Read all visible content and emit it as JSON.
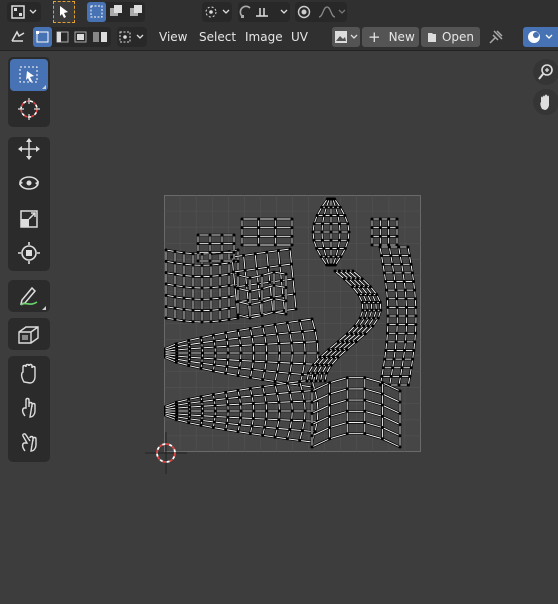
{
  "header": {
    "menus": [
      "View",
      "Select",
      "Image",
      "UV"
    ],
    "new_label": "New",
    "open_label": "Open"
  },
  "colors": {
    "header_bg": "#303030",
    "viewport_bg": "#3d3d3d",
    "accent": "#4772b3",
    "cursor_red": "#e04545",
    "mesh_white": "#ffffff"
  },
  "icons": {
    "editor_type": "image-editor-icon",
    "select_mode": "cursor-arrow-icon",
    "pivot": "pivot-point-icon",
    "snap": "snap-icon",
    "proportional": "proportional-editing-icon",
    "sync": "uv-sync-icon",
    "pin": "pin-icon"
  },
  "toolbar": {
    "tools": [
      {
        "name": "select-box-tool",
        "icon": "select-box-icon"
      },
      {
        "name": "cursor-tool",
        "icon": "cursor-icon"
      },
      {
        "name": "move-tool",
        "icon": "move-icon"
      },
      {
        "name": "rotate-tool",
        "icon": "rotate-icon"
      },
      {
        "name": "scale-tool",
        "icon": "scale-icon"
      },
      {
        "name": "transform-tool",
        "icon": "transform-icon"
      },
      {
        "name": "annotate-tool",
        "icon": "annotate-icon"
      },
      {
        "name": "rip-region-tool",
        "icon": "rip-region-icon"
      },
      {
        "name": "grab-tool",
        "icon": "grab-icon"
      },
      {
        "name": "relax-tool",
        "icon": "relax-icon"
      },
      {
        "name": "pinch-tool",
        "icon": "pinch-icon"
      }
    ]
  },
  "navigation": [
    "zoom-icon",
    "pan-hand-icon"
  ]
}
